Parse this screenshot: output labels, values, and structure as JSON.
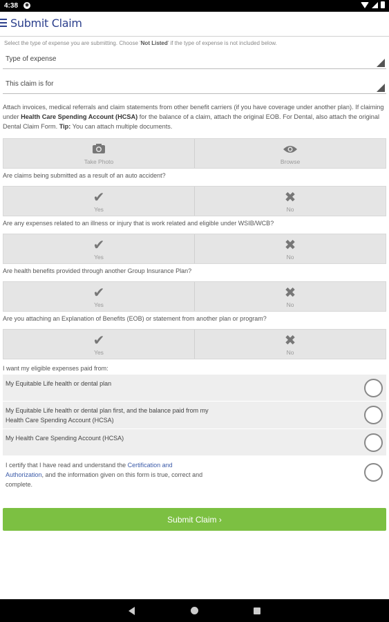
{
  "status": {
    "time": "4:38"
  },
  "app": {
    "title": "Submit Claim"
  },
  "intro": {
    "text_a": "Select the type of expense you are submitting. Choose '",
    "bold": "Not Listed",
    "text_b": "' if the type of expense is not included below."
  },
  "selects": [
    {
      "label": "Type of expense"
    },
    {
      "label": "This claim is for"
    }
  ],
  "attach": {
    "p1": "Attach invoices, medical referrals and claim statements from other benefit carriers (if you have coverage under another plan). If claiming under ",
    "bold1": "Health Care Spending Account (HCSA)",
    "p2": " for the balance of a claim, attach the original EOB. For Dental, also attach the original Dental Claim Form. ",
    "bold2": "Tip:",
    "p3": " You can attach multiple documents."
  },
  "attach_buttons": {
    "photo": "Take Photo",
    "browse": "Browse"
  },
  "questions": [
    {
      "text": "Are claims being submitted as a result of an auto accident?",
      "yes": "Yes",
      "no": "No"
    },
    {
      "text": "Are any expenses related to an illness or injury that is work related and eligible under WSIB/WCB?",
      "yes": "Yes",
      "no": "No"
    },
    {
      "text": "Are health benefits provided through another Group Insurance Plan?",
      "yes": "Yes",
      "no": "No"
    },
    {
      "text": "Are you attaching an Explanation of Benefits (EOB) or statement from another plan or program?",
      "yes": "Yes",
      "no": "No"
    }
  ],
  "payment": {
    "label": "I want my eligible expenses paid from:",
    "options": [
      {
        "line1": "My Equitable Life health or dental plan",
        "line2": ""
      },
      {
        "line1": "My Equitable Life health or dental plan first, and the balance paid from my",
        "line2": "Health Care Spending Account (HCSA)"
      },
      {
        "line1": "My Health Care Spending Account (HCSA)",
        "line2": ""
      }
    ]
  },
  "certify": {
    "a": "I certify that I have read and understand the ",
    "link1": "Certification and",
    "link2": "Authorization",
    "b": ", and the information given on this form is true, correct and",
    "c": "complete."
  },
  "submit": {
    "label": "Submit Claim ›"
  },
  "colors": {
    "accent": "#2b3f8c",
    "submit": "#7cc042",
    "link": "#3a5aa8"
  },
  "icons": {
    "camera": "camera-icon",
    "eye": "eye-icon",
    "check": "check-icon",
    "cross": "close-icon",
    "menu": "menu-icon"
  }
}
